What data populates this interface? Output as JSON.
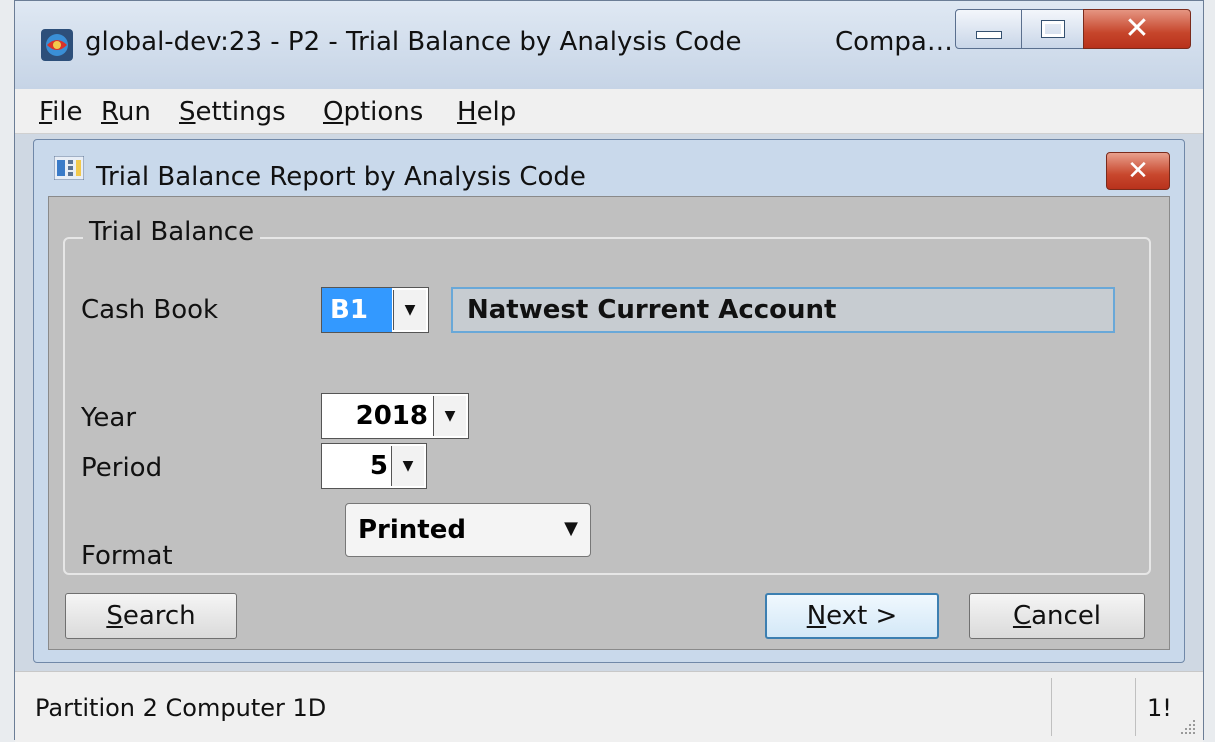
{
  "window": {
    "title": "global-dev:23 - P2 - Trial Balance by Analysis Code",
    "title_right": "Compa…"
  },
  "menu": [
    {
      "hotkey": "F",
      "rest": "ile"
    },
    {
      "hotkey": "R",
      "rest": "un"
    },
    {
      "hotkey": "S",
      "rest": "ettings"
    },
    {
      "hotkey": "O",
      "rest": "ptions"
    },
    {
      "hotkey": "H",
      "rest": "elp"
    }
  ],
  "dialog": {
    "title": "Trial Balance Report by Analysis Code",
    "group_label": "Trial Balance",
    "cash_book": {
      "label": "Cash Book",
      "value": "B1",
      "description": "Natwest Current Account"
    },
    "year": {
      "label": "Year",
      "value": "2018"
    },
    "period": {
      "label": "Period",
      "value": "5"
    },
    "format": {
      "label": "Format",
      "value": "Printed"
    }
  },
  "buttons": {
    "search": {
      "hotkey": "S",
      "rest": "earch"
    },
    "next": {
      "hotkey": "N",
      "rest": "ext >"
    },
    "cancel": {
      "hotkey": "C",
      "rest": "ancel"
    }
  },
  "status": {
    "text": "Partition 2 Computer 1D",
    "right": "1!"
  },
  "colors": {
    "selection": "#3399ff",
    "close_button": "#c6452b",
    "default_button_border": "#3c7fb1"
  }
}
